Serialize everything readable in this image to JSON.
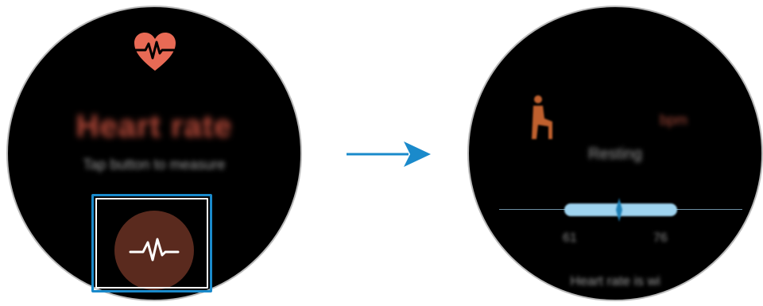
{
  "left_screen": {
    "title": "Heart rate",
    "subtitle": "Tap button to measure",
    "measure_button_icon": "heartbeat-line-icon",
    "heart_icon": "heart-pulse-icon"
  },
  "arrow_icon": "right-arrow-icon",
  "right_screen": {
    "status_icon": "sitting-person-icon",
    "bpm_value": "",
    "bpm_unit": "bpm",
    "status": "Resting",
    "range_low": "61",
    "range_high": "76",
    "bottom_text": "Heart rate is wi"
  },
  "colors": {
    "accent_blue": "#1a8acb",
    "heart_red": "#e86a55",
    "button_brown": "#5a2a1e",
    "range_bar": "#9fd3ef"
  }
}
